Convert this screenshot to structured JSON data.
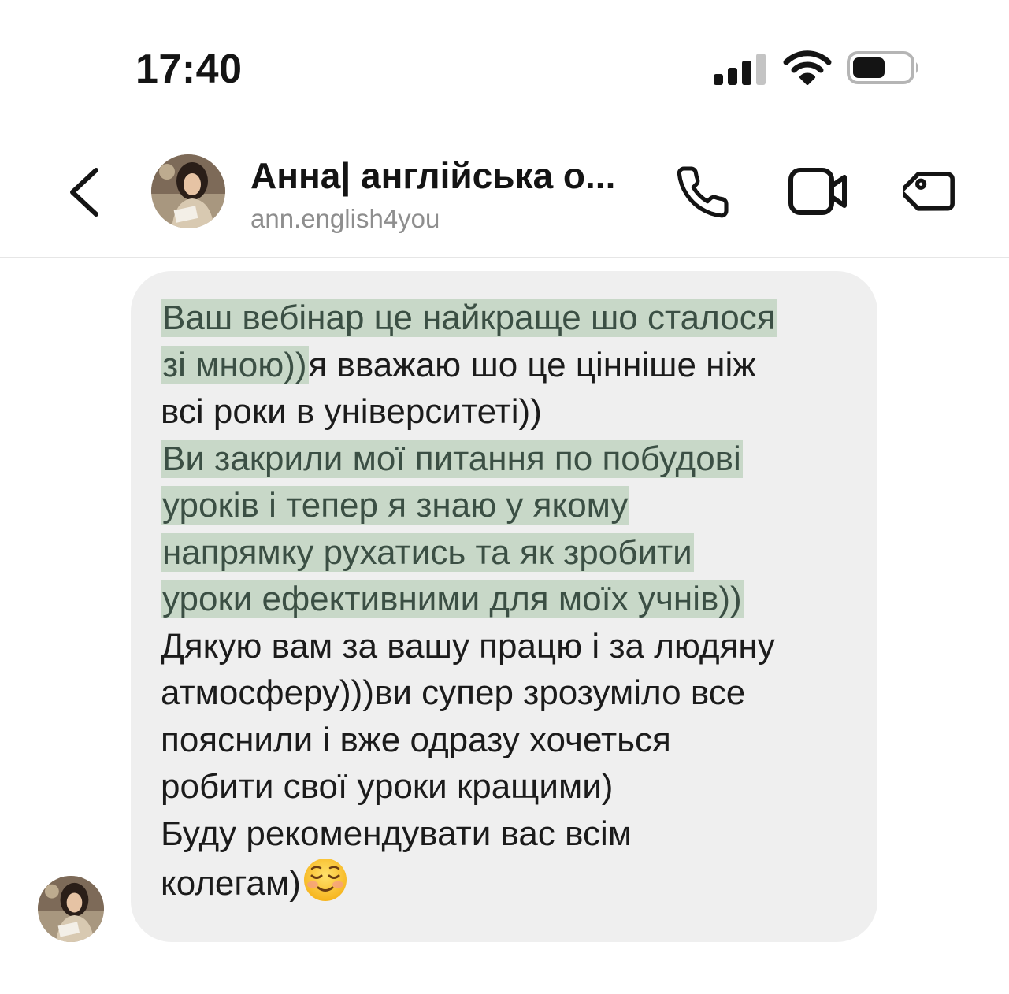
{
  "status_bar": {
    "time": "17:40",
    "icons": [
      "cellular-signal-icon",
      "wifi-icon",
      "battery-icon"
    ]
  },
  "header": {
    "contact_name": "Анна| англійська о...",
    "contact_username": "ann.english4you",
    "icons": [
      "back-chevron-icon",
      "avatar",
      "phone-icon",
      "video-camera-icon",
      "tag-icon"
    ]
  },
  "message": {
    "hl1_line1": "Ваш вебінар це найкраще шо сталося",
    "hl1_line2": "зі мною))",
    "line2_rest": "я вважаю шо це цінніше ніж",
    "line3": "всі роки в університеті))",
    "hl2_line1": "Ви закрили мої питання по побудові",
    "hl2_line2": "уроків і тепер я знаю у якому",
    "hl2_line3": "напрямку рухатись та як зробити",
    "hl2_line4": "уроки ефективними для моїх учнів))",
    "line8": "Дякую вам за вашу працю і за людяну",
    "line9": "атмосферу)))ви супер зрозуміло все",
    "line10": "пояснили і вже одразу хочеться",
    "line11": "робити свої уроки кращими)",
    "line12": "Буду рекомендувати вас всім",
    "line13": "колегам)",
    "emoji": "smiling-face-icon"
  },
  "colors": {
    "highlight_bg": "#c8d8c8",
    "highlight_text": "#3b4f44",
    "bubble_bg": "#efefef",
    "username_gray": "#8e8e8e"
  }
}
